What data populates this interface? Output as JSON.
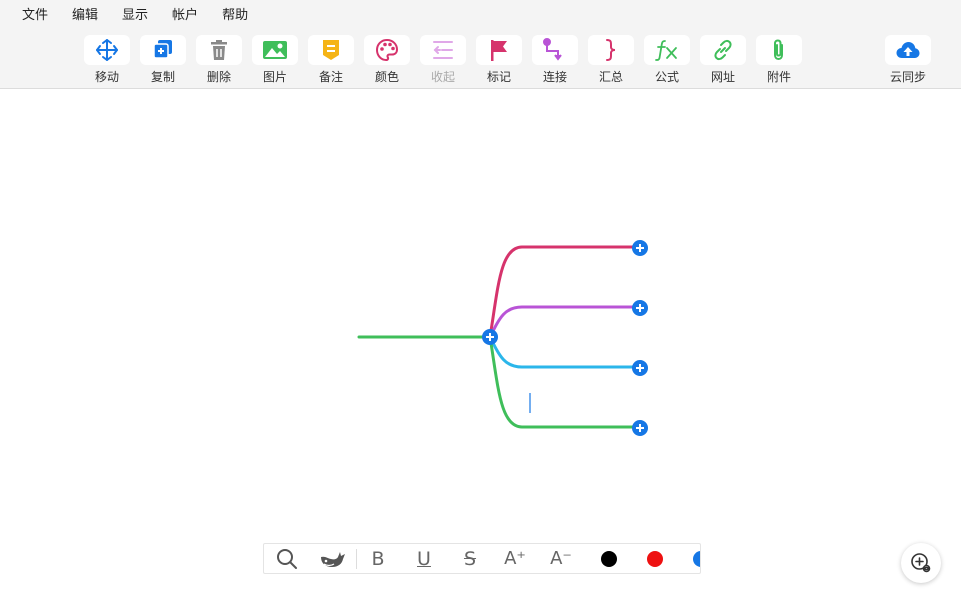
{
  "menu": [
    "文件",
    "编辑",
    "显示",
    "帐户",
    "帮助"
  ],
  "toolbar": {
    "move": "移动",
    "copy": "复制",
    "delete": "删除",
    "image": "图片",
    "note": "备注",
    "color": "颜色",
    "collapse": "收起",
    "mark": "标记",
    "connect": "连接",
    "summary": "汇总",
    "formula": "公式",
    "url": "网址",
    "attachment": "附件",
    "cloud_sync": "云同步"
  },
  "colors": {
    "accent": "#1677e5",
    "branch_pink": "#d6336c",
    "branch_purple": "#b954d6",
    "branch_cyan": "#2bb6ea",
    "branch_green": "#3fbe5a",
    "swatch_black": "#000000",
    "swatch_red": "#ee1111",
    "swatch_blue": "#1677e5"
  },
  "format_bar": {
    "search_icon": "search-icon",
    "whale_icon": "whale-icon",
    "bold": "B",
    "underline": "U",
    "strike": "S",
    "font_up": "A⁺",
    "font_down": "A⁻"
  }
}
